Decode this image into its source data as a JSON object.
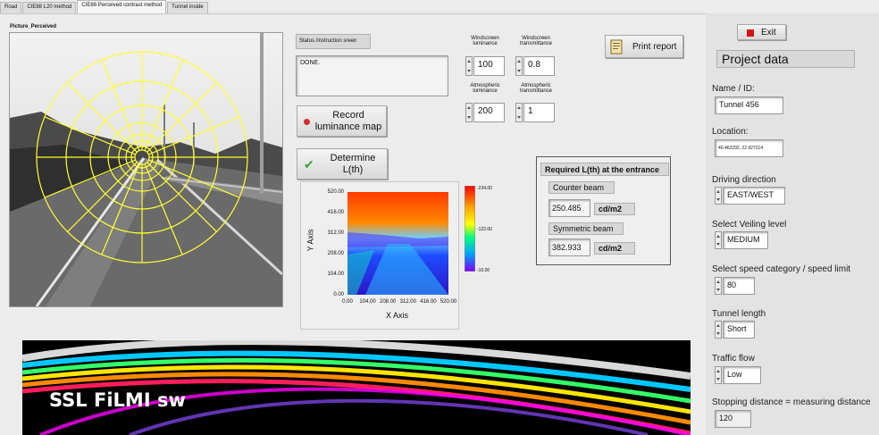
{
  "tabs": [
    {
      "label": "Road"
    },
    {
      "label": "CIE88 L20 method"
    },
    {
      "label": "CIE88 Perceived contrast method"
    },
    {
      "label": "Tunnel inside"
    }
  ],
  "picture": {
    "label": "Picture_Perceived"
  },
  "status": {
    "label": "Status /instruction sreen",
    "text": "DONE."
  },
  "windscreen": {
    "luminance_label": "Windscreen luminance",
    "luminance_value": "100",
    "transmittance_label": "Windscreen transmittance",
    "transmittance_value": "0.8"
  },
  "atmospheric": {
    "luminance_label": "Atmospheric luminance",
    "luminance_value": "200",
    "transmittance_label": "Atmospheric transmittance",
    "transmittance_value": "1"
  },
  "buttons": {
    "print_report": "Print report",
    "record_luminance_line1": "Record",
    "record_luminance_line2": "luminance map",
    "determine_line1": "Determine",
    "determine_line2": "L(th)",
    "exit": "Exit"
  },
  "required": {
    "title": "Required L(th) at the entrance",
    "counter_beam_label": "Counter beam",
    "counter_beam_value": "250.485",
    "counter_beam_unit": "cd/m2",
    "symmetric_beam_label": "Symmetric beam",
    "symmetric_beam_value": "382.933",
    "symmetric_beam_unit": "cd/m2"
  },
  "heatmap": {
    "x_axis_label": "X Axis",
    "y_axis_label": "Y Axis",
    "x_ticks": [
      "0.00",
      "104.00",
      "208.00",
      "312.00",
      "416.00",
      "520.00"
    ],
    "y_ticks": [
      "520.00",
      "416.00",
      "312.00",
      "208.00",
      "104.00",
      "0.00"
    ],
    "colorbar_ticks": [
      "234.00",
      "122.00",
      "10.00"
    ]
  },
  "project": {
    "title": "Project data",
    "name_label": "Name / ID:",
    "name_value": "Tunnel 456",
    "location_label": "Location:",
    "location_value": "40.462292, 22.927214",
    "direction_label": "Driving direction",
    "direction_value": "EAST/WEST",
    "veiling_label": "Select Veiling level",
    "veiling_value": "MEDIUM",
    "speed_label": "Select speed category / speed limit",
    "speed_value": "80",
    "tunnel_length_label": "Tunnel length",
    "tunnel_length_value": "Short",
    "traffic_label": "Traffic flow",
    "traffic_value": "Low",
    "stopping_label": "Stopping distance = measuring distance",
    "stopping_value": "120"
  },
  "banner": {
    "text": "SSL FiLMI sw"
  },
  "colors": {
    "exit_red": "#d41414",
    "record_dot": "#d32f2f",
    "check_green": "#3aa23a",
    "overlay_yellow": "#ffff33"
  },
  "icons": [
    "stop-icon",
    "record-dot-icon",
    "checkmark-icon",
    "printer-icon"
  ]
}
